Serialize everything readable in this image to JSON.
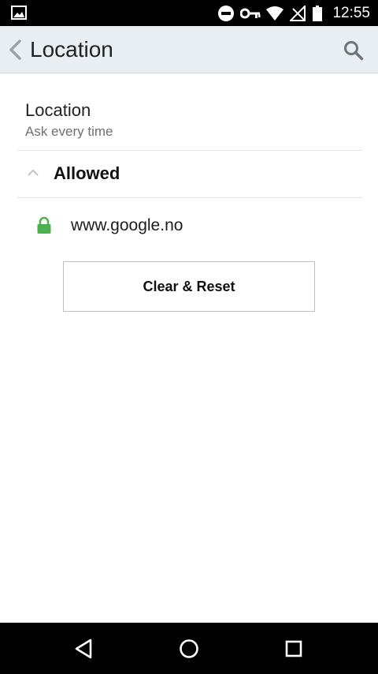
{
  "status_bar": {
    "time": "12:55",
    "icons": [
      "image-icon",
      "do-not-disturb-icon",
      "vpn-key-icon",
      "wifi-icon",
      "no-signal-icon",
      "battery-icon"
    ]
  },
  "app_bar": {
    "title": "Location",
    "back_icon": "chevron-left-icon",
    "search_icon": "search-icon"
  },
  "permission": {
    "title": "Location",
    "subtitle": "Ask every time"
  },
  "allowed_section": {
    "label": "Allowed",
    "expanded": true,
    "sites": [
      {
        "url": "www.google.no",
        "icon": "lock-icon",
        "icon_color": "#4caf50"
      }
    ]
  },
  "reset_button": {
    "label": "Clear & Reset"
  },
  "nav_bar": {
    "icons": [
      "back-triangle-icon",
      "home-circle-icon",
      "recents-square-icon"
    ]
  },
  "colors": {
    "app_bar_bg": "#e9eef2",
    "lock_green": "#4caf50",
    "status_bar_bg": "#000000"
  }
}
